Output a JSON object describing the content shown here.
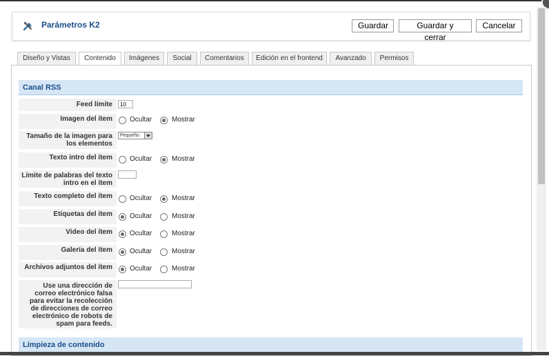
{
  "header": {
    "title": "Parámetros K2",
    "buttons": {
      "save": "Guardar",
      "save_close": "Guardar y cerrar",
      "cancel": "Cancelar"
    }
  },
  "tabs": [
    "Diseño y Vistas",
    "Contenido",
    "Imágenes",
    "Social",
    "Comentarios",
    "Edición en el frontend",
    "Avanzado",
    "Permisos"
  ],
  "active_tab": "Contenido",
  "sections": {
    "rss": "Canal RSS",
    "cleanup": "Limpieza de contenido"
  },
  "options": {
    "hide": "Ocultar",
    "show": "Mostrar"
  },
  "fields": {
    "feed_limit": {
      "label": "Feed límite",
      "value": "10"
    },
    "item_image": {
      "label": "Imagen del ítem",
      "selected": "Mostrar"
    },
    "image_size": {
      "label": "Tamaño de la imagen para los elementos",
      "value": "Pequeño"
    },
    "intro_text": {
      "label": "Texto intro del ítem",
      "selected": "Mostrar"
    },
    "intro_word_limit": {
      "label": "Límite de palabras del texto intro en el ítem",
      "value": ""
    },
    "full_text": {
      "label": "Texto completo del ítem",
      "selected": "Mostrar"
    },
    "item_tags": {
      "label": "Etiquetas del ítem",
      "selected": "Ocultar"
    },
    "item_video": {
      "label": "Video del ítem",
      "selected": "Ocultar"
    },
    "item_gallery": {
      "label": "Galería del ítem",
      "selected": "Ocultar"
    },
    "item_attachments": {
      "label": "Archivos adjuntos del ítem",
      "selected": "Ocultar"
    },
    "fake_email": {
      "label": "Use una dirección de correo electrónico falsa para evitar la recolección de direcciones de correo electrónico de robots de spam para feeds.",
      "value": ""
    }
  }
}
